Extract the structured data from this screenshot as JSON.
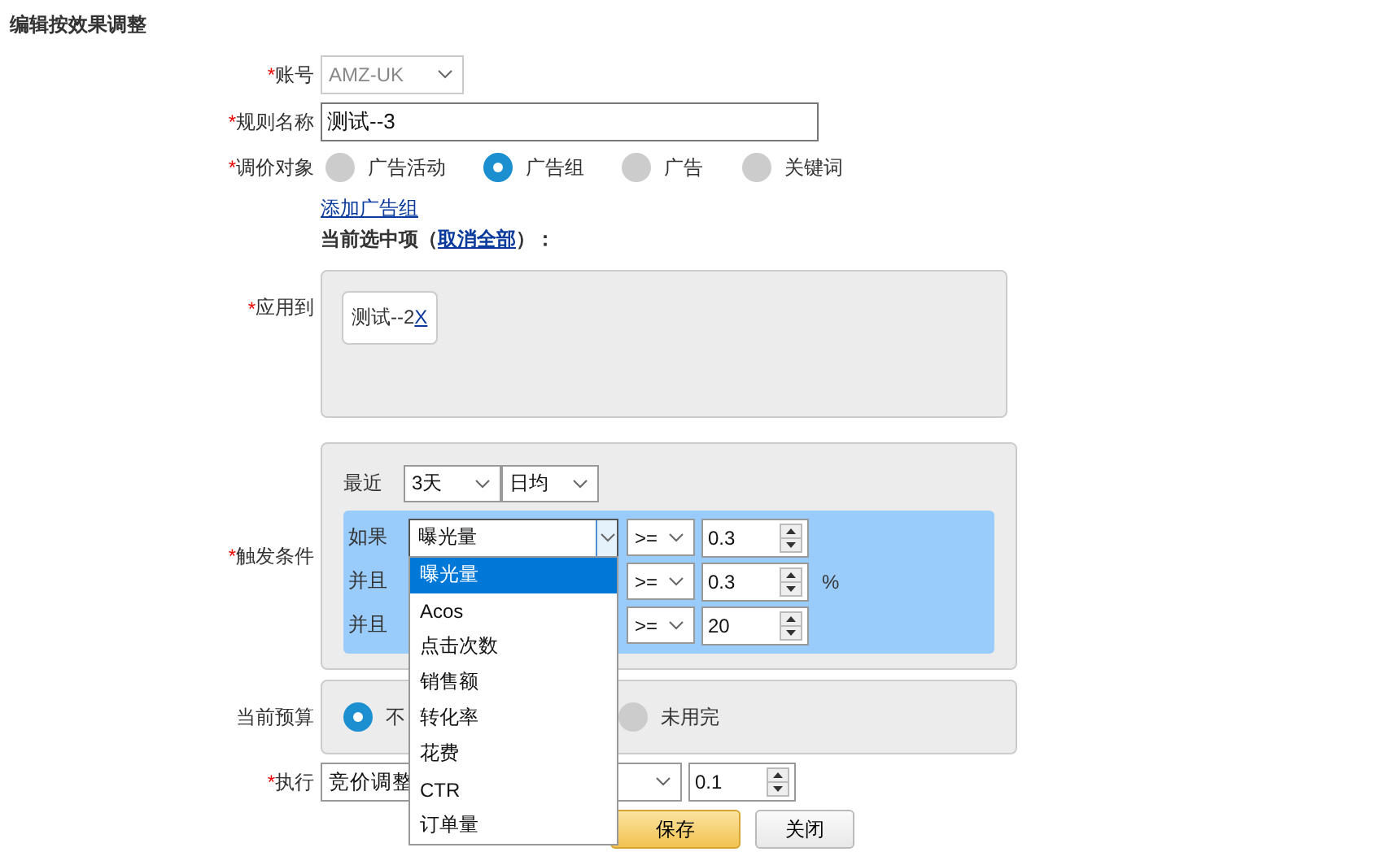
{
  "page_title": "编辑按效果调整",
  "account": {
    "required_mark": "*",
    "label": "账号",
    "value": "AMZ-UK",
    "disabled": true
  },
  "rule_name": {
    "required_mark": "*",
    "label": "规则名称",
    "value": "测试--3"
  },
  "target": {
    "required_mark": "*",
    "label": "调价对象",
    "options": [
      {
        "label": "广告活动",
        "selected": false
      },
      {
        "label": "广告组",
        "selected": true
      },
      {
        "label": "广告",
        "selected": false
      },
      {
        "label": "关键词",
        "selected": false
      }
    ],
    "add_link": "添加广告组",
    "current_selection": {
      "prefix": "当前选中项（",
      "link": "取消全部",
      "suffix": "）："
    }
  },
  "apply_to": {
    "required_mark": "*",
    "label": "应用到",
    "chips": [
      {
        "label": "测试--2",
        "remove": "X"
      }
    ]
  },
  "trigger": {
    "required_mark": "*",
    "label": "触发条件",
    "period_label": "最近",
    "days": "3天",
    "aggregate": "日均",
    "conditions": [
      {
        "connector": "如果",
        "metric": "曝光量",
        "operator": ">=",
        "value": "0.3",
        "expanded": true,
        "options": [
          {
            "label": "曝光量",
            "selected": true
          },
          {
            "label": "Acos",
            "selected": false
          },
          {
            "label": "点击次数",
            "selected": false
          },
          {
            "label": "销售额",
            "selected": false
          },
          {
            "label": "转化率",
            "selected": false
          },
          {
            "label": "花费",
            "selected": false
          },
          {
            "label": "CTR",
            "selected": false
          },
          {
            "label": "订单量",
            "selected": false
          }
        ]
      },
      {
        "connector": "并且",
        "operator": ">=",
        "value": "0.3",
        "unit": "%"
      },
      {
        "connector": "并且",
        "operator": ">=",
        "value": "20"
      }
    ]
  },
  "budget": {
    "label": "当前预算",
    "options": [
      {
        "label": "不",
        "selected": true
      },
      {
        "label": "未用完",
        "selected": false
      }
    ]
  },
  "execute": {
    "required_mark": "*",
    "label": "执行",
    "action": "竞价调整",
    "amount": "0.1"
  },
  "buttons": [
    {
      "label": "保存",
      "kind": "primary"
    },
    {
      "label": "关闭",
      "kind": "default"
    }
  ]
}
